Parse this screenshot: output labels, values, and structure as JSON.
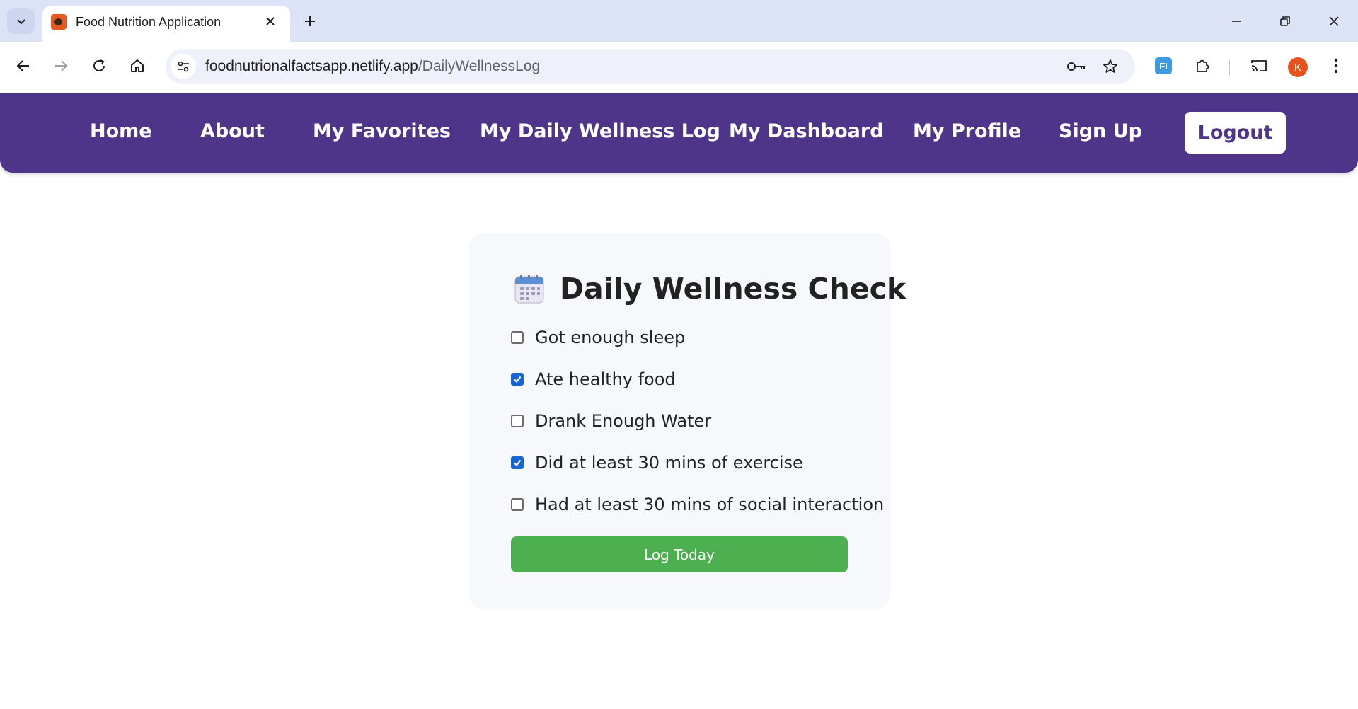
{
  "browser": {
    "tab_title": "Food Nutrition Application",
    "url_domain": "foodnutrionalfactsapp.netlify.app",
    "url_path": "/DailyWellnessLog",
    "profile_initial": "K",
    "extension_label": "FI"
  },
  "nav": {
    "items": [
      "Home",
      "About",
      "My Favorites",
      "My Daily Wellness Log",
      "My Dashboard",
      "My Profile",
      "Sign Up"
    ],
    "logout_label": "Logout"
  },
  "card": {
    "title": "Daily Wellness Check",
    "items": [
      {
        "label": "Got enough sleep",
        "checked": false
      },
      {
        "label": "Ate healthy food",
        "checked": true
      },
      {
        "label": "Drank Enough Water",
        "checked": false
      },
      {
        "label": "Did at least 30 mins of exercise",
        "checked": true
      },
      {
        "label": "Had at least 30 mins of social interaction",
        "checked": false
      }
    ],
    "button_label": "Log Today"
  },
  "colors": {
    "nav_bg": "#4f3589",
    "button_green": "#4caf50",
    "checkbox_blue": "#1766d3"
  }
}
